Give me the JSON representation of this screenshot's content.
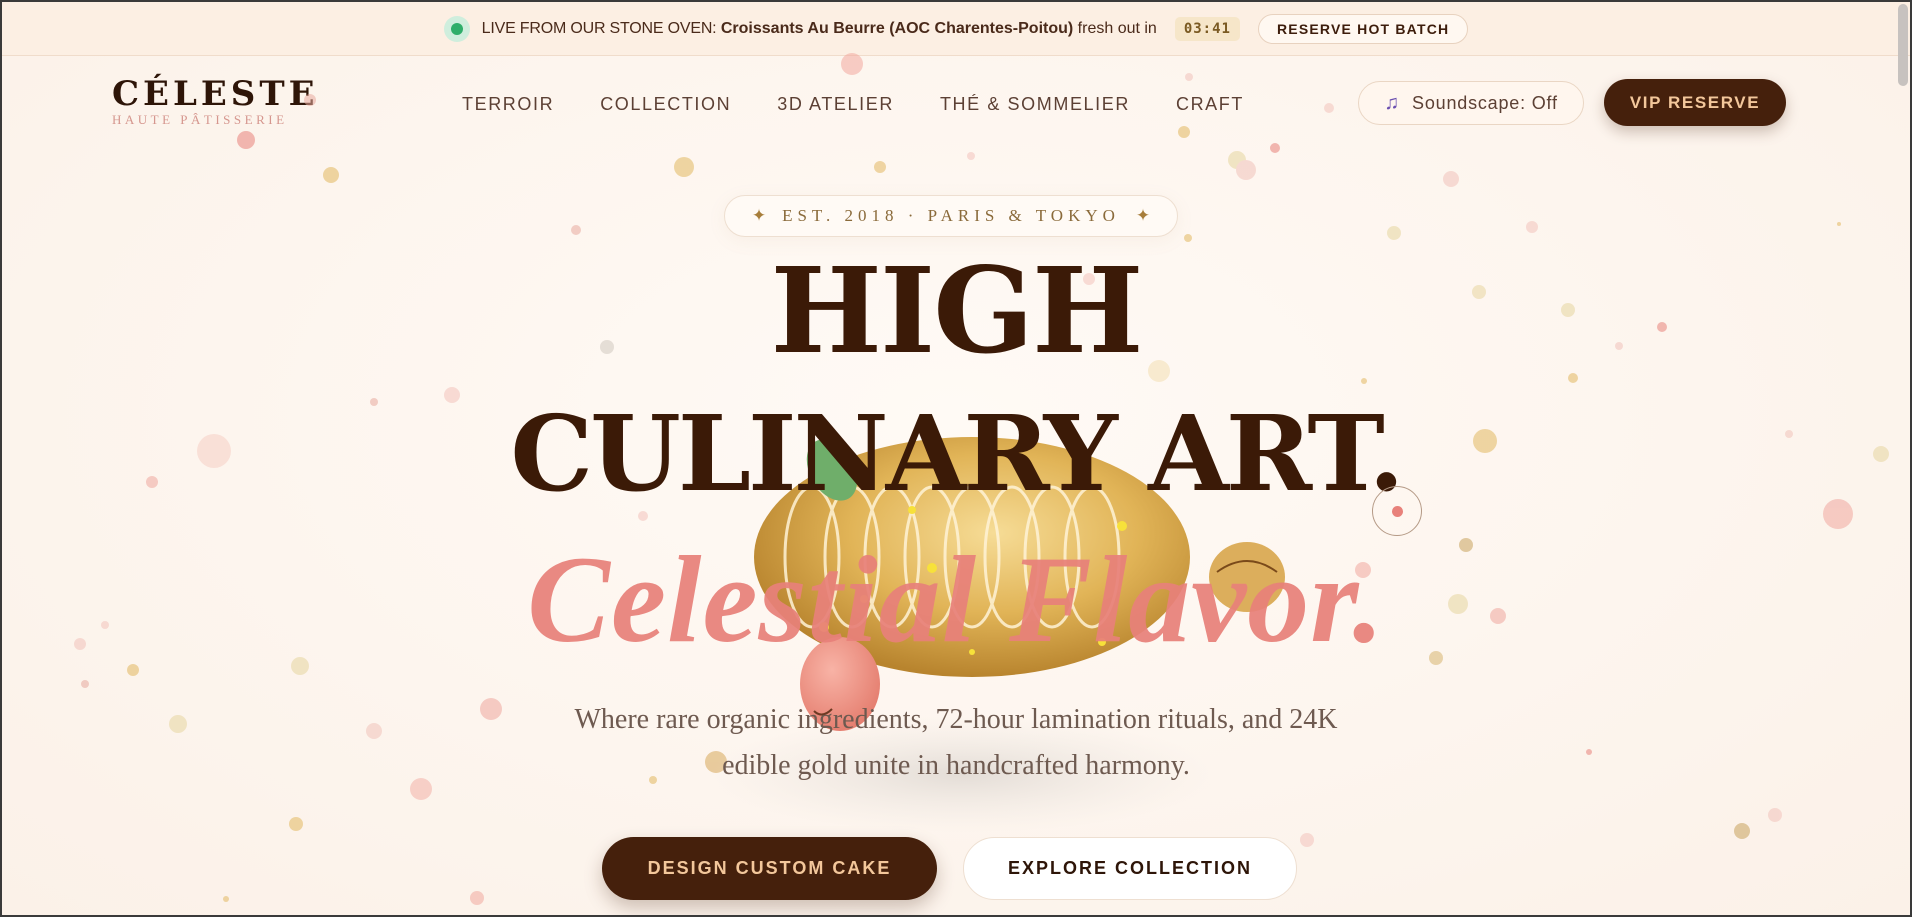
{
  "announcement": {
    "lead": "LIVE FROM OUR STONE OVEN:",
    "item": "Croissants Au Beurre (AOC Charentes-Poitou)",
    "suffix": "fresh out in",
    "timer": "03:41",
    "cta": "RESERVE HOT BATCH"
  },
  "brand": {
    "name": "CÉLESTE",
    "subtitle": "HAUTE PÂTISSERIE"
  },
  "nav": {
    "items": [
      "TERROIR",
      "COLLECTION",
      "3D ATELIER",
      "THÉ & SOMMELIER",
      "CRAFT"
    ]
  },
  "header": {
    "soundscape": "Soundscape: Off",
    "vip": "VIP RESERVE"
  },
  "hero": {
    "badge": "EST. 2018 · PARIS & TOKYO",
    "title_line1": "HIGH",
    "title_line2": "CULINARY ART.",
    "title_line3": "Celestial Flavor.",
    "tagline_line1": "Where rare organic ingredients, 72-hour lamination rituals, and 24K",
    "tagline_line2": "edible gold unite in handcrafted harmony.",
    "cta_primary": "DESIGN CUSTOM CAKE",
    "cta_secondary": "EXPLORE COLLECTION"
  },
  "icons": {
    "live": "live-indicator-icon",
    "music": "music-note-icon",
    "star": "sparkle-star-icon"
  },
  "colors": {
    "brand_dark": "#45200c",
    "accent_coral": "#e8817a",
    "gold": "#d9a94a",
    "live_green": "#2fae6a",
    "background": "#fdf7f1"
  }
}
